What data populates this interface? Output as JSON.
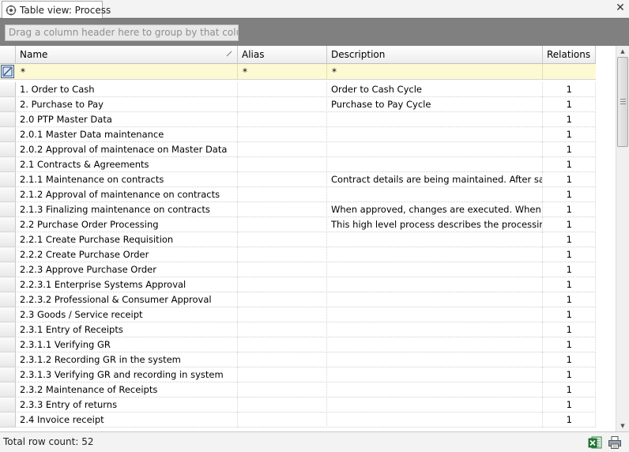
{
  "window": {
    "tab_title": "Table view: Process",
    "close_symbol": "✕"
  },
  "group_panel": {
    "hint": "Drag a column header here to group by that column."
  },
  "columns": {
    "name": "Name",
    "alias": "Alias",
    "description": "Description",
    "relations": "Relations"
  },
  "filter": {
    "name": "*",
    "alias": "*",
    "description": "*"
  },
  "rows": [
    {
      "name": "1. Order to Cash",
      "alias": "",
      "description": "Order to Cash Cycle",
      "relations": "1"
    },
    {
      "name": "2. Purchase to Pay",
      "alias": "",
      "description": "Purchase to Pay Cycle",
      "relations": "1"
    },
    {
      "name": "2.0 PTP Master Data",
      "alias": "",
      "description": "",
      "relations": "1"
    },
    {
      "name": "2.0.1 Master Data maintenance",
      "alias": "",
      "description": "",
      "relations": "1"
    },
    {
      "name": "2.0.2 Approval of maintenace on Master Data",
      "alias": "",
      "description": "",
      "relations": "1"
    },
    {
      "name": "2.1 Contracts & Agreements",
      "alias": "",
      "description": "",
      "relations": "1"
    },
    {
      "name": "2.1.1 Maintenance on contracts",
      "alias": "",
      "description": "Contract details are being maintained. After saving",
      "relations": "1"
    },
    {
      "name": "2.1.2 Approval of maintenance on contracts",
      "alias": "",
      "description": "",
      "relations": "1"
    },
    {
      "name": "2.1.3 Finalizing maintenance on contracts",
      "alias": "",
      "description": "When approved, changes are executed. When",
      "relations": "1"
    },
    {
      "name": "2.2 Purchase Order Processing",
      "alias": "",
      "description": "This high level process describes the processing of",
      "relations": "1"
    },
    {
      "name": "2.2.1 Create Purchase Requisition",
      "alias": "",
      "description": "",
      "relations": "1"
    },
    {
      "name": "2.2.2 Create Purchase Order",
      "alias": "",
      "description": "",
      "relations": "1"
    },
    {
      "name": "2.2.3 Approve Purchase Order",
      "alias": "",
      "description": "",
      "relations": "1"
    },
    {
      "name": "2.2.3.1 Enterprise Systems Approval",
      "alias": "",
      "description": "",
      "relations": "1"
    },
    {
      "name": "2.2.3.2 Professional & Consumer Approval",
      "alias": "",
      "description": "",
      "relations": "1"
    },
    {
      "name": "2.3 Goods / Service receipt",
      "alias": "",
      "description": "",
      "relations": "1"
    },
    {
      "name": "2.3.1 Entry of Receipts",
      "alias": "",
      "description": "",
      "relations": "1"
    },
    {
      "name": "2.3.1.1 Verifying GR",
      "alias": "",
      "description": "",
      "relations": "1"
    },
    {
      "name": "2.3.1.2 Recording GR in the system",
      "alias": "",
      "description": "",
      "relations": "1"
    },
    {
      "name": "2.3.1.3 Verifying GR and recording in system",
      "alias": "",
      "description": "",
      "relations": "1"
    },
    {
      "name": "2.3.2 Maintenance of Receipts",
      "alias": "",
      "description": "",
      "relations": "1"
    },
    {
      "name": "2.3.3 Entry of returns",
      "alias": "",
      "description": "",
      "relations": "1"
    },
    {
      "name": "2.4 Invoice receipt",
      "alias": "",
      "description": "",
      "relations": "1"
    }
  ],
  "status": {
    "row_count": "Total row count: 52"
  },
  "icons": {
    "tab": "process-view-icon",
    "sort": "sort-ascending-icon",
    "filter_selector": "filter-row-selector-icon",
    "excel": "excel-export-icon",
    "print": "print-icon"
  },
  "colors": {
    "filter_row": "#fdf9d3",
    "group_panel": "#808080"
  }
}
